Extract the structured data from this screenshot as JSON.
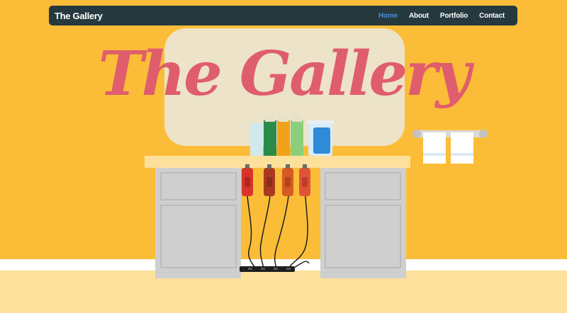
{
  "nav": {
    "brand": "The Gallery",
    "links": [
      {
        "label": "Home",
        "active": true
      },
      {
        "label": "About",
        "active": false
      },
      {
        "label": "Portfolio",
        "active": false
      },
      {
        "label": "Contact",
        "active": false
      }
    ]
  },
  "hero": {
    "title": "The Gallery"
  },
  "colors": {
    "background": "#fbbd38",
    "navbar": "#26393e",
    "active_link": "#4a8fd0",
    "title": "#df5d6c",
    "mirror": "#ede3c8",
    "counter_top": "#fde09c",
    "cabinet": "#cfcfcf"
  },
  "illustration": {
    "icons": [
      "mirror-icon",
      "spray-bottles-icon",
      "jar-icon",
      "towel-rack-icon",
      "vanity-cabinet-icon",
      "hair-clippers-icon",
      "power-strip-icon"
    ]
  }
}
